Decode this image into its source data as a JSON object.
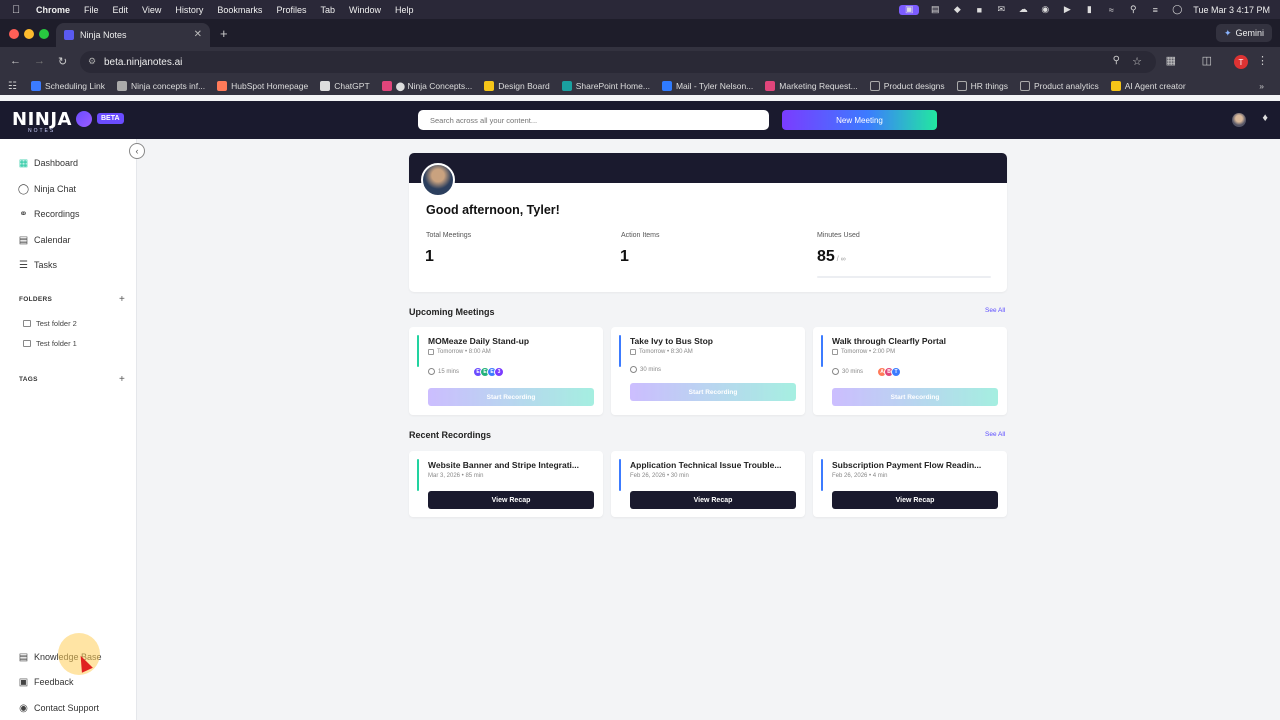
{
  "menubar": {
    "app": "Chrome",
    "items": [
      "File",
      "Edit",
      "View",
      "History",
      "Bookmarks",
      "Profiles",
      "Tab",
      "Window",
      "Help"
    ],
    "datetime": "Tue Mar 3  4:17 PM"
  },
  "browser": {
    "tab_title": "Ninja Notes",
    "url": "beta.ninjanotes.ai",
    "gemini_label": "Gemini",
    "profile_initial": "T",
    "bookmarks": [
      {
        "label": "Scheduling Link",
        "color": "#3b7bff"
      },
      {
        "label": "Ninja concepts inf...",
        "color": "#aaaaaa"
      },
      {
        "label": "HubSpot Homepage",
        "color": "#ff7a59"
      },
      {
        "label": "ChatGPT",
        "color": "#dddddd"
      },
      {
        "label": "⬤ Ninja Concepts...",
        "color": "#e0457b"
      },
      {
        "label": "Design Board",
        "color": "#f5c518"
      },
      {
        "label": "SharePoint Home...",
        "color": "#1aa0a0"
      },
      {
        "label": "Mail - Tyler Nelson...",
        "color": "#2f7bff"
      },
      {
        "label": "Marketing Request...",
        "color": "#e0457b"
      },
      {
        "label": "Product designs",
        "color": "#888888"
      },
      {
        "label": "HR things",
        "color": "#888888"
      },
      {
        "label": "Product analytics",
        "color": "#888888"
      },
      {
        "label": "AI Agent creator",
        "color": "#f5c518"
      }
    ]
  },
  "header": {
    "logo": "NINJA",
    "logo_sub": "NOTES",
    "beta": "BETA",
    "search_placeholder": "Search across all your content...",
    "new_meeting": "New Meeting"
  },
  "sidebar": {
    "nav": [
      {
        "label": "Dashboard",
        "icon": "grid-icon"
      },
      {
        "label": "Ninja Chat",
        "icon": "chat-icon"
      },
      {
        "label": "Recordings",
        "icon": "headphones-icon"
      },
      {
        "label": "Calendar",
        "icon": "calendar-icon"
      },
      {
        "label": "Tasks",
        "icon": "tasks-icon"
      }
    ],
    "folders_title": "FOLDERS",
    "folders": [
      "Test folder 2",
      "Test folder 1"
    ],
    "tags_title": "TAGS",
    "bottom": [
      {
        "label": "Knowledge Base",
        "icon": "book-icon"
      },
      {
        "label": "Feedback",
        "icon": "feedback-icon"
      },
      {
        "label": "Contact Support",
        "icon": "support-icon"
      }
    ]
  },
  "dashboard": {
    "greeting": "Good afternoon, Tyler!",
    "stats": [
      {
        "label": "Total Meetings",
        "value": "1"
      },
      {
        "label": "Action Items",
        "value": "1"
      },
      {
        "label": "Minutes Used",
        "value": "85",
        "unit": "/ ∞"
      }
    ],
    "upcoming_title": "Upcoming Meetings",
    "recent_title": "Recent Recordings",
    "see_all": "See All",
    "start_recording": "Start Recording",
    "view_recap": "View Recap",
    "upcoming": [
      {
        "title": "MOMeaze Daily Stand-up",
        "when": "Tomorrow • 8:00 AM",
        "duration": "15 mins",
        "accent": "#22d3a0",
        "avatars": [
          {
            "i": "E",
            "c": "#6a4cff"
          },
          {
            "i": "E",
            "c": "#22b07a"
          },
          {
            "i": "E",
            "c": "#3c7bff"
          },
          {
            "i": "3",
            "c": "#7b3cff"
          }
        ]
      },
      {
        "title": "Take Ivy to Bus Stop",
        "when": "Tomorrow • 8:30 AM",
        "duration": "30 mins",
        "accent": "#3c7bff",
        "avatars": []
      },
      {
        "title": "Walk through Clearfly Portal",
        "when": "Tomorrow • 2:00 PM",
        "duration": "30 mins",
        "accent": "#3c7bff",
        "avatars": [
          {
            "i": "A",
            "c": "#ff7a59"
          },
          {
            "i": "B",
            "c": "#e0457b"
          },
          {
            "i": "T",
            "c": "#3c7bff"
          }
        ]
      }
    ],
    "recent": [
      {
        "title": "Website Banner and Stripe Integrati...",
        "meta": "Mar 3, 2026 • 85 min",
        "accent": "#22d3a0"
      },
      {
        "title": "Application Technical Issue Trouble...",
        "meta": "Feb 26, 2026 • 30 min",
        "accent": "#3c7bff"
      },
      {
        "title": "Subscription Payment Flow Readin...",
        "meta": "Feb 26, 2026 • 4 min",
        "accent": "#3c7bff"
      }
    ]
  }
}
